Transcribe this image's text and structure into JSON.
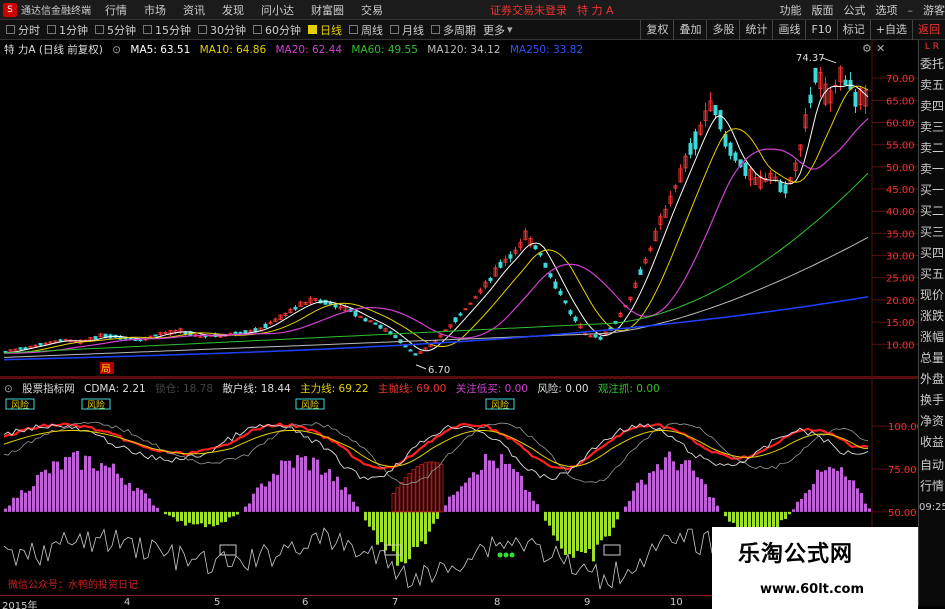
{
  "app": {
    "title": "通达信金融终端",
    "logo": "S"
  },
  "menu": [
    "行情",
    "市场",
    "资讯",
    "发现",
    "问小达",
    "财富圈",
    "交易"
  ],
  "login_status": "证券交易未登录",
  "stock_name": "特 力 A",
  "right_menu": [
    "功能",
    "版面",
    "公式",
    "选项"
  ],
  "guest": "游客",
  "periods": [
    "分时",
    "1分钟",
    "5分钟",
    "15分钟",
    "30分钟",
    "60分钟",
    "日线",
    "周线",
    "月线",
    "多周期",
    "更多"
  ],
  "active_period": "日线",
  "right_tools": [
    "复权",
    "叠加",
    "多股",
    "统计",
    "画线",
    "F10",
    "标记",
    "+自选",
    "返回"
  ],
  "main_legend": {
    "name": "特 力A (日线 前复权)",
    "ma5": "MA5: 63.51",
    "ma10": "MA10: 64.86",
    "ma20": "MA20: 62.44",
    "ma60": "MA60: 49.55",
    "ma120": "MA120: 34.12",
    "ma250": "MA250: 33.82"
  },
  "annotations": {
    "high": "74.37",
    "low": "6.70",
    "marker": "局"
  },
  "sub_legend": {
    "name": "股票指标网",
    "cdma": "CDMA: 2.21",
    "hint": "锁仓: 18.78",
    "retail": "散户线: 18.44",
    "main": "主力线: 69.22",
    "main_sell": "主抛线: 69.00",
    "focus_buy": "关注低买: 0.00",
    "risk": "风险: 0.00",
    "watch": "观注抓: 0.00"
  },
  "sub_markers": [
    "风险",
    "风险",
    "风险",
    "风险"
  ],
  "side_items": [
    "委托",
    "卖五",
    "卖四",
    "卖三",
    "卖二",
    "卖一",
    "买一",
    "买二",
    "买三",
    "买四",
    "买五",
    "现价",
    "涨跌",
    "涨幅",
    "总量",
    "外盘",
    "换手",
    "净资",
    "收益",
    "自动",
    "行情",
    "09:25"
  ],
  "side_top": "L R",
  "footer": {
    "brand": "微信公众号：水鸭的投资日记",
    "x_labels": [
      "2015年",
      "4",
      "5",
      "6",
      "7",
      "8",
      "9",
      "10",
      "11"
    ]
  },
  "watermark": {
    "cn": "乐淘公式网",
    "url": "www.60lt.com"
  },
  "chart_data": [
    {
      "type": "candlestick",
      "title": "特力A 日线",
      "y_ticks": [
        10,
        15,
        20,
        25,
        30,
        35,
        40,
        45,
        50,
        55,
        60,
        65,
        70
      ],
      "ylim": [
        6,
        75
      ],
      "annotations": {
        "max": 74.37,
        "min": 6.7
      }
    },
    {
      "type": "bar",
      "title": "股票指标网",
      "y_ticks": [
        50,
        75,
        100
      ],
      "ylim": [
        40,
        110
      ]
    }
  ],
  "colors": {
    "up": "#e33",
    "down": "#3fd8d8",
    "ma5": "#ffffff",
    "ma10": "#e6d100",
    "ma20": "#d040d0",
    "ma60": "#30c030",
    "ma120": "#bbbbbb",
    "ma250": "#2040ff"
  }
}
